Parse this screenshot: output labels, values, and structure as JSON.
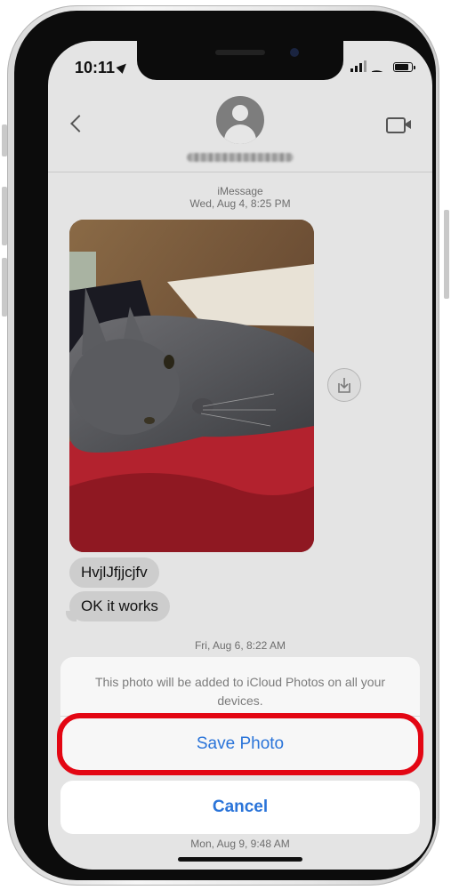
{
  "status_bar": {
    "time": "10:11",
    "battery_level": 0.85,
    "signal_bars": 3
  },
  "conversation": {
    "service_label": "iMessage",
    "first_timestamp": "Wed, Aug 4, 8:25 PM",
    "messages": [
      {
        "text": "HvjlJfjjcjfv"
      },
      {
        "text": "OK it works"
      }
    ],
    "second_timestamp": "Fri, Aug 6, 8:22 AM",
    "third_timestamp": "Mon, Aug 9, 9:48 AM"
  },
  "action_sheet": {
    "message": "This photo will be added to iCloud Photos on all your devices.",
    "save_label": "Save Photo",
    "cancel_label": "Cancel"
  },
  "colors": {
    "accent_blue": "#2a74d9",
    "highlight_red": "#e30613",
    "bubble_gray": "#cdcdcd"
  }
}
